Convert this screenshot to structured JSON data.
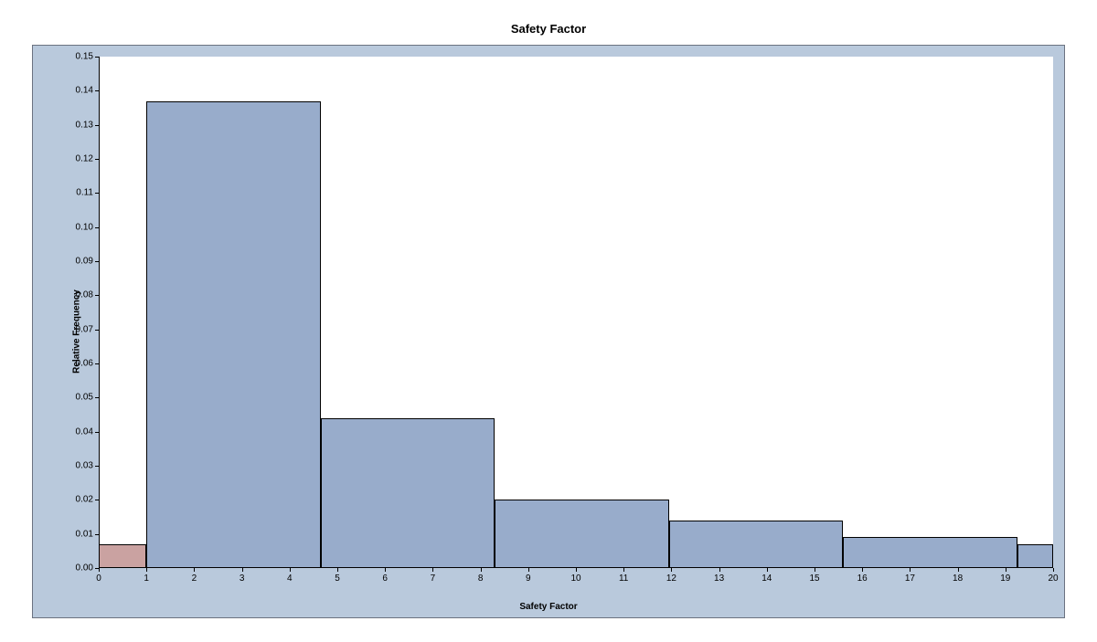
{
  "chart_data": {
    "type": "bar",
    "title": "Safety Factor",
    "xlabel": "Safety Factor",
    "ylabel": "Relative Frequency",
    "xlim": [
      0,
      20
    ],
    "ylim": [
      0,
      0.15
    ],
    "xticks": [
      0,
      1,
      2,
      3,
      4,
      5,
      6,
      7,
      8,
      9,
      10,
      11,
      12,
      13,
      14,
      15,
      16,
      17,
      18,
      19,
      20
    ],
    "yticks": [
      0.0,
      0.01,
      0.02,
      0.03,
      0.04,
      0.05,
      0.06,
      0.07,
      0.08,
      0.09,
      0.1,
      0.11,
      0.12,
      0.13,
      0.14,
      0.15
    ],
    "bars": [
      {
        "x0": 0.0,
        "x1": 1.0,
        "y": 0.007,
        "color": "red"
      },
      {
        "x0": 1.0,
        "x1": 4.65,
        "y": 0.137,
        "color": "blue"
      },
      {
        "x0": 4.65,
        "x1": 8.3,
        "y": 0.044,
        "color": "blue"
      },
      {
        "x0": 8.3,
        "x1": 11.95,
        "y": 0.02,
        "color": "blue"
      },
      {
        "x0": 11.95,
        "x1": 15.6,
        "y": 0.014,
        "color": "blue"
      },
      {
        "x0": 15.6,
        "x1": 19.25,
        "y": 0.009,
        "color": "blue"
      },
      {
        "x0": 19.25,
        "x1": 20.0,
        "y": 0.007,
        "color": "blue"
      }
    ]
  }
}
